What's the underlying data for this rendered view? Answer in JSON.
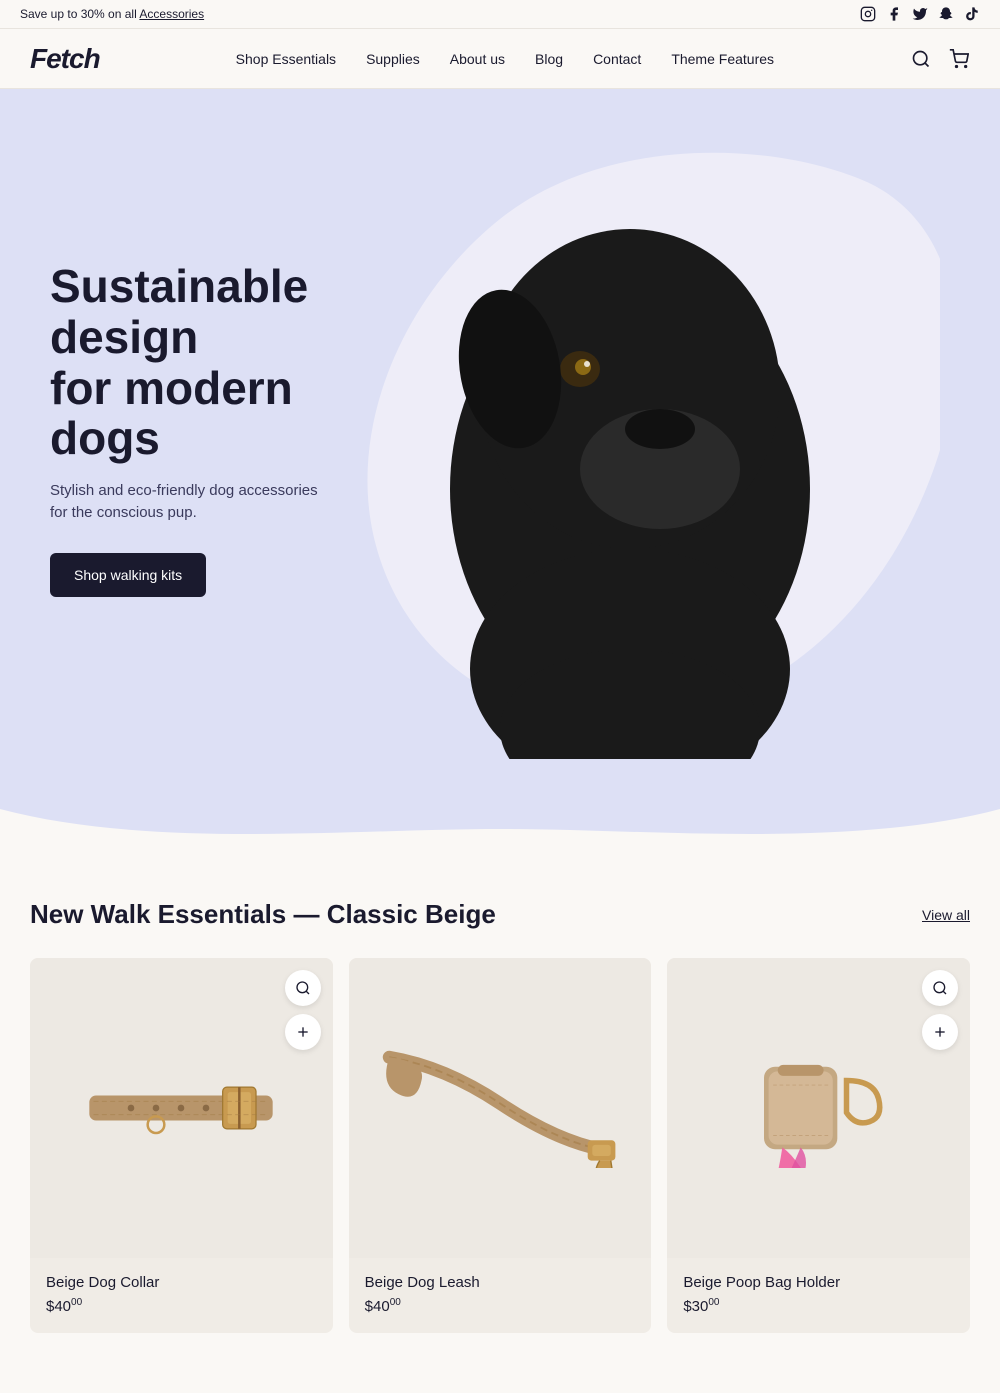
{
  "announcement": {
    "text": "Save up to 30% on all ",
    "link_text": "Accessories"
  },
  "social_icons": [
    {
      "name": "instagram",
      "symbol": "📷"
    },
    {
      "name": "facebook",
      "symbol": "f"
    },
    {
      "name": "twitter",
      "symbol": "🐦"
    },
    {
      "name": "snapchat",
      "symbol": "👻"
    },
    {
      "name": "tiktok",
      "symbol": "♪"
    }
  ],
  "header": {
    "logo": "Fetch",
    "nav_items": [
      {
        "label": "Shop Essentials"
      },
      {
        "label": "Supplies"
      },
      {
        "label": "About us"
      },
      {
        "label": "Blog"
      },
      {
        "label": "Contact"
      },
      {
        "label": "Theme Features"
      }
    ]
  },
  "hero": {
    "heading_line1": "Sustainable design",
    "heading_line2": "for modern dogs",
    "subtext": "Stylish and eco-friendly dog accessories for the conscious pup.",
    "cta_label": "Shop walking kits"
  },
  "products_section": {
    "section_title": "New Walk Essentials — Classic Beige",
    "view_all_label": "View all",
    "products": [
      {
        "name": "Beige Dog Collar",
        "price_whole": "$40",
        "price_cents": "00"
      },
      {
        "name": "Beige Dog Leash",
        "price_whole": "$40",
        "price_cents": "00"
      },
      {
        "name": "Beige Poop Bag Holder",
        "price_whole": "$30",
        "price_cents": "00"
      }
    ]
  },
  "colors": {
    "hero_bg": "#dde0f5",
    "page_bg": "#faf8f5",
    "dark": "#1a1a2e",
    "product_bg": "#ede9e3"
  }
}
